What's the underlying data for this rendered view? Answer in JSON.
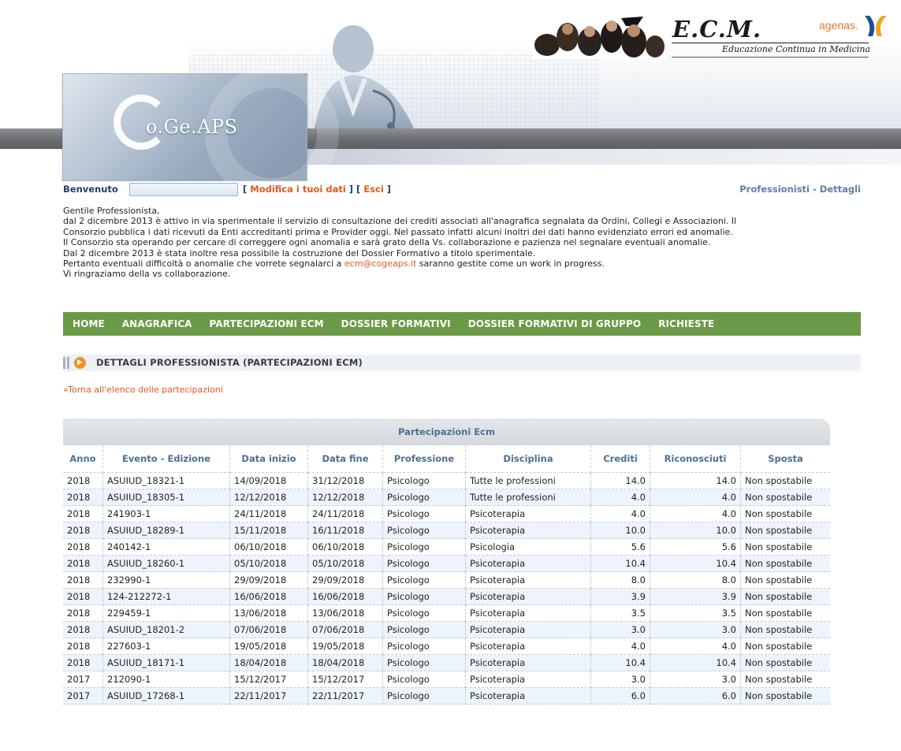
{
  "header": {
    "logo_text": "o.Ge.APS",
    "ecm_title": "E.C.M.",
    "ecm_subtitle": "Educazione Continua in Medicina",
    "agenas_text": "agenas."
  },
  "welcome": {
    "label": "Benvenuto",
    "link_open": "[ ",
    "edit_link": "Modifica i tuoi dati",
    "sep": " ] [ ",
    "logout_link": "Esci",
    "link_close": " ]",
    "section_path": "Professionisti - Dettagli"
  },
  "intro": {
    "line1": "Gentile Professionista,",
    "line2": "dal 2 dicembre 2013 è attivo in via sperimentale il servizio di consultazione dei crediti associati all'anagrafica segnalata da Ordini, Collegi e Associazioni. Il",
    "line3": "Consorzio pubblica i dati ricevuti da Enti accreditanti prima e Provider oggi. Nel passato infatti alcuni inoltri dei dati hanno evidenziato errori ed anomalie.",
    "line4": "Il Consorzio sta operando per cercare di correggere ogni anomalia e sarà grato della Vs. collaborazione e pazienza nel segnalare eventuali anomalie.",
    "line5": "Dal 2 dicembre 2013 è stata inoltre resa possibile la costruzione del Dossier Formativo a titolo sperimentale.",
    "line6_pre": "Pertanto eventuali difficoltà o anomalie che vorrete segnalarci a ",
    "email": "ecm@cogeaps.it",
    "line6_post": " saranno gestite come un work in progress.",
    "line7": "Vi ringraziamo della vs collaborazione."
  },
  "nav": {
    "items": [
      "HOME",
      "ANAGRAFICA",
      "PARTECIPAZIONI ECM",
      "DOSSIER FORMATIVI",
      "DOSSIER FORMATIVI DI GRUPPO",
      "RICHIESTE"
    ]
  },
  "section": {
    "title": "DETTAGLI PROFESSIONISTA (PARTECIPAZIONI ECM)",
    "back_link": "«Torna all'elenco delle partecipazioni"
  },
  "table": {
    "caption": "Partecipazioni Ecm",
    "columns": [
      "Anno",
      "Evento - Edizione",
      "Data inizio",
      "Data fine",
      "Professione",
      "Disciplina",
      "Crediti",
      "Riconosciuti",
      "Sposta"
    ],
    "rows": [
      [
        "2018",
        "ASUIUD_18321-1",
        "14/09/2018",
        "31/12/2018",
        "Psicologo",
        "Tutte le professioni",
        "14.0",
        "14.0",
        "Non spostabile"
      ],
      [
        "2018",
        "ASUIUD_18305-1",
        "12/12/2018",
        "12/12/2018",
        "Psicologo",
        "Tutte le professioni",
        "4.0",
        "4.0",
        "Non spostabile"
      ],
      [
        "2018",
        "241903-1",
        "24/11/2018",
        "24/11/2018",
        "Psicologo",
        "Psicoterapia",
        "4.0",
        "4.0",
        "Non spostabile"
      ],
      [
        "2018",
        "ASUIUD_18289-1",
        "15/11/2018",
        "16/11/2018",
        "Psicologo",
        "Psicoterapia",
        "10.0",
        "10.0",
        "Non spostabile"
      ],
      [
        "2018",
        "240142-1",
        "06/10/2018",
        "06/10/2018",
        "Psicologo",
        "Psicologia",
        "5.6",
        "5.6",
        "Non spostabile"
      ],
      [
        "2018",
        "ASUIUD_18260-1",
        "05/10/2018",
        "05/10/2018",
        "Psicologo",
        "Psicoterapia",
        "10.4",
        "10.4",
        "Non spostabile"
      ],
      [
        "2018",
        "232990-1",
        "29/09/2018",
        "29/09/2018",
        "Psicologo",
        "Psicoterapia",
        "8.0",
        "8.0",
        "Non spostabile"
      ],
      [
        "2018",
        "124-212272-1",
        "16/06/2018",
        "16/06/2018",
        "Psicologo",
        "Psicoterapia",
        "3.9",
        "3.9",
        "Non spostabile"
      ],
      [
        "2018",
        "229459-1",
        "13/06/2018",
        "13/06/2018",
        "Psicologo",
        "Psicoterapia",
        "3.5",
        "3.5",
        "Non spostabile"
      ],
      [
        "2018",
        "ASUIUD_18201-2",
        "07/06/2018",
        "07/06/2018",
        "Psicologo",
        "Psicoterapia",
        "3.0",
        "3.0",
        "Non spostabile"
      ],
      [
        "2018",
        "227603-1",
        "19/05/2018",
        "19/05/2018",
        "Psicologo",
        "Psicoterapia",
        "4.0",
        "4.0",
        "Non spostabile"
      ],
      [
        "2018",
        "ASUIUD_18171-1",
        "18/04/2018",
        "18/04/2018",
        "Psicologo",
        "Psicoterapia",
        "10.4",
        "10.4",
        "Non spostabile"
      ],
      [
        "2017",
        "212090-1",
        "15/12/2017",
        "15/12/2017",
        "Psicologo",
        "Psicoterapia",
        "3.0",
        "3.0",
        "Non spostabile"
      ],
      [
        "2017",
        "ASUIUD_17268-1",
        "22/11/2017",
        "22/11/2017",
        "Psicologo",
        "Psicoterapia",
        "6.0",
        "6.0",
        "Non spostabile"
      ]
    ]
  },
  "icons": {
    "section_bullet": "arrow-circle-icon",
    "agenas_mark": "agenas-logo-icon"
  },
  "colors": {
    "nav_bg": "#6a9a46",
    "link_orange": "#e05a1e",
    "header_blue": "#4b6f98"
  }
}
